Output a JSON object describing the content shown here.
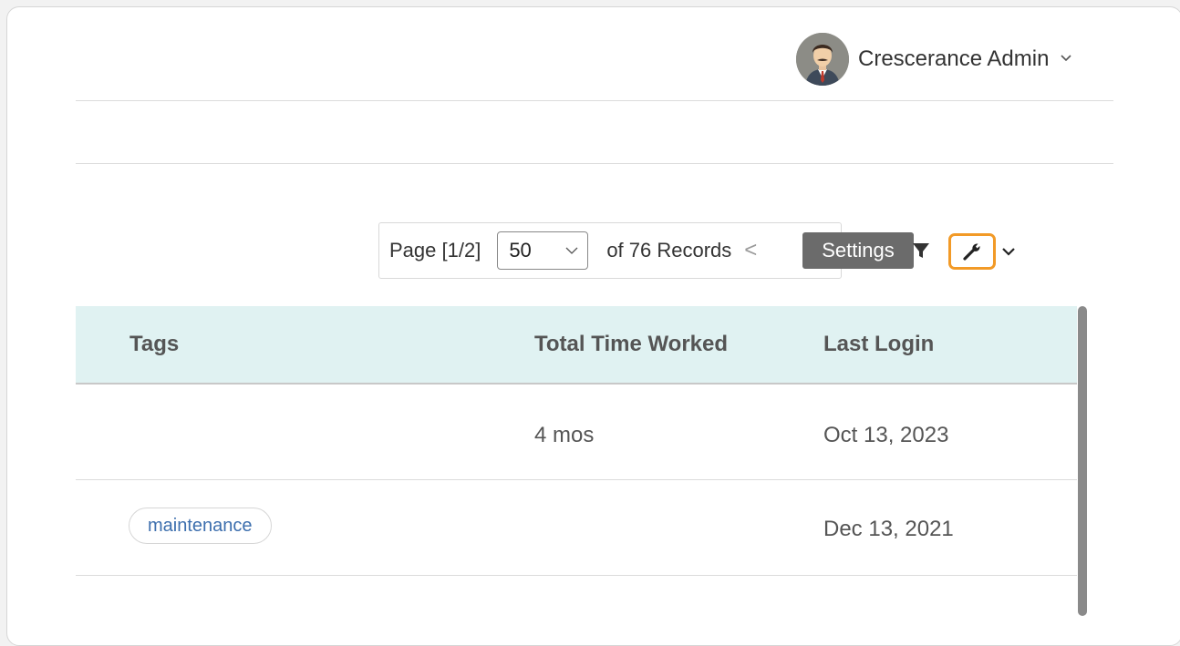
{
  "header": {
    "user_name": "Crescerance Admin"
  },
  "pagination": {
    "page_label": "Page [1/2]",
    "page_size": "50",
    "records_label": "of 76 Records",
    "prev_symbol": "<"
  },
  "toolbar": {
    "tooltip": "Settings",
    "filter_icon": "filter-icon",
    "settings_icon": "wrench-icon",
    "accent_color": "#f29a27"
  },
  "table": {
    "columns": [
      "Tags",
      "Total Time Worked",
      "Last Login"
    ],
    "rows": [
      {
        "tag": "",
        "total_time_worked": "4 mos",
        "last_login": "Oct 13, 2023"
      },
      {
        "tag": "maintenance",
        "total_time_worked": "",
        "last_login": "Dec 13, 2021"
      }
    ]
  }
}
